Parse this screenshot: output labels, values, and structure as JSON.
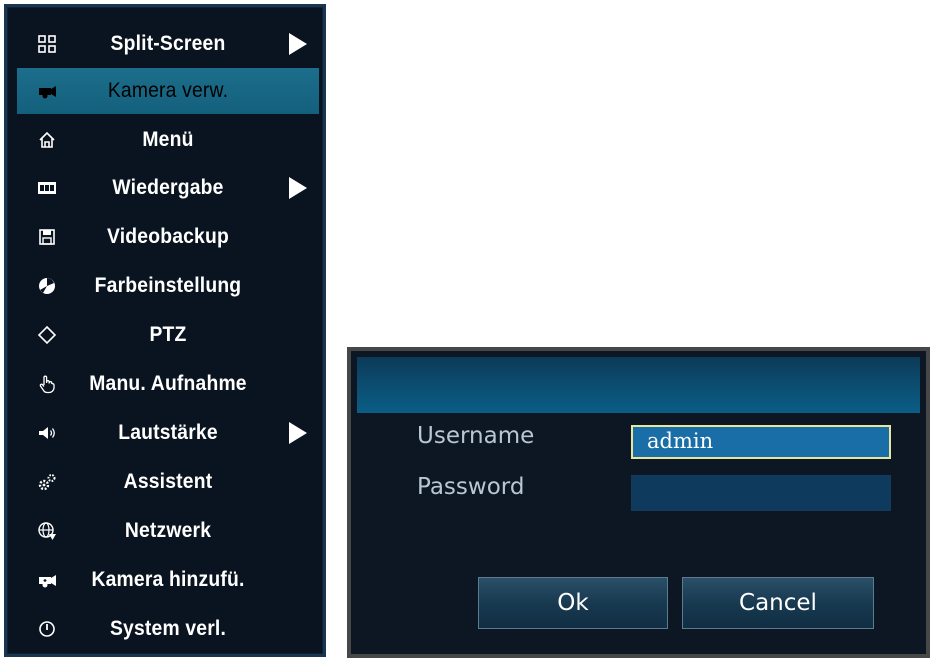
{
  "menu": {
    "items": [
      {
        "label": "Split-Screen",
        "icon": "split-screen-icon",
        "has_submenu": true
      },
      {
        "label": "Kamera verw.",
        "icon": "camera-icon",
        "has_submenu": false,
        "selected": true
      },
      {
        "label": "Menü",
        "icon": "home-icon",
        "has_submenu": false
      },
      {
        "label": "Wiedergabe",
        "icon": "film-icon",
        "has_submenu": true
      },
      {
        "label": "Videobackup",
        "icon": "floppy-disk-icon",
        "has_submenu": false
      },
      {
        "label": "Farbeinstellung",
        "icon": "color-palette-icon",
        "has_submenu": false
      },
      {
        "label": "PTZ",
        "icon": "ptz-icon",
        "has_submenu": false
      },
      {
        "label": "Manu. Aufnahme",
        "icon": "hand-pointer-icon",
        "has_submenu": false
      },
      {
        "label": "Lautstärke",
        "icon": "speaker-icon",
        "has_submenu": true
      },
      {
        "label": "Assistent",
        "icon": "gears-icon",
        "has_submenu": false
      },
      {
        "label": "Netzwerk",
        "icon": "globe-icon",
        "has_submenu": false
      },
      {
        "label": "Kamera hinzufü.",
        "icon": "camera-add-icon",
        "has_submenu": false
      },
      {
        "label": "System verl.",
        "icon": "power-icon",
        "has_submenu": false
      }
    ]
  },
  "login": {
    "username_label": "Username",
    "username_value": "admin",
    "password_label": "Password",
    "password_value": "",
    "ok_label": "Ok",
    "cancel_label": "Cancel"
  },
  "colors": {
    "menu_background": "#0a1420",
    "selected_item": "#1a6a88",
    "dialog_header": "#0b4d70",
    "field_focus_border": "#e8e59c"
  }
}
